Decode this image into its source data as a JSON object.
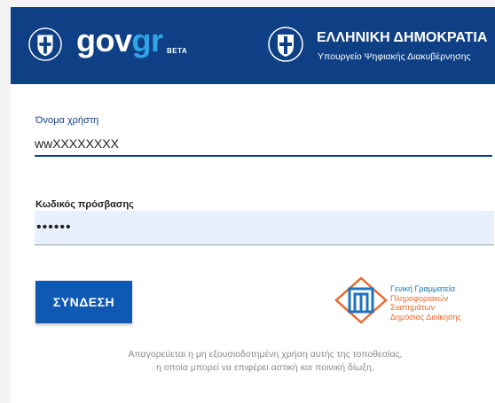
{
  "header": {
    "logo_gov": "gov",
    "logo_gr": "gr",
    "beta": "BETA",
    "republic_title": "ΕΛΛΗΝΙΚΗ ΔΗΜΟΚΡΑΤΙΑ",
    "ministry": "Υπουργείο Ψηφιακής Διακυβέρνησης"
  },
  "form": {
    "username_label": "Όνομα χρήστη",
    "username_value": "wwXXXXXXXX",
    "password_label": "Κωδικός πρόσβασης",
    "password_value": "••••••",
    "login_button": "ΣΥΝΔΕΣΗ"
  },
  "gsis": {
    "line1": "Γενική Γραμματεία",
    "line2": "Πληροφοριακών",
    "line3": "Συστημάτων",
    "line4": "Δημόσιας Διοίκησης"
  },
  "footer": {
    "warning_line1": "Απαγορεύεται η μη εξουσιοδοτημένη χρήση αυτής της τοποθεσίας,",
    "warning_line2": "η οποία μπορεί να επιφέρει αστική και ποινική δίωξη."
  },
  "colors": {
    "header_bg": "#0f4085",
    "accent": "#0f59b3",
    "gr_blue": "#2fa4e7",
    "gsis_orange": "#e8692f"
  },
  "icons": {
    "left_seal": "greek-coat-of-arms-icon",
    "right_seal": "greek-coat-of-arms-icon",
    "gsis": "gsis-logo-icon"
  }
}
